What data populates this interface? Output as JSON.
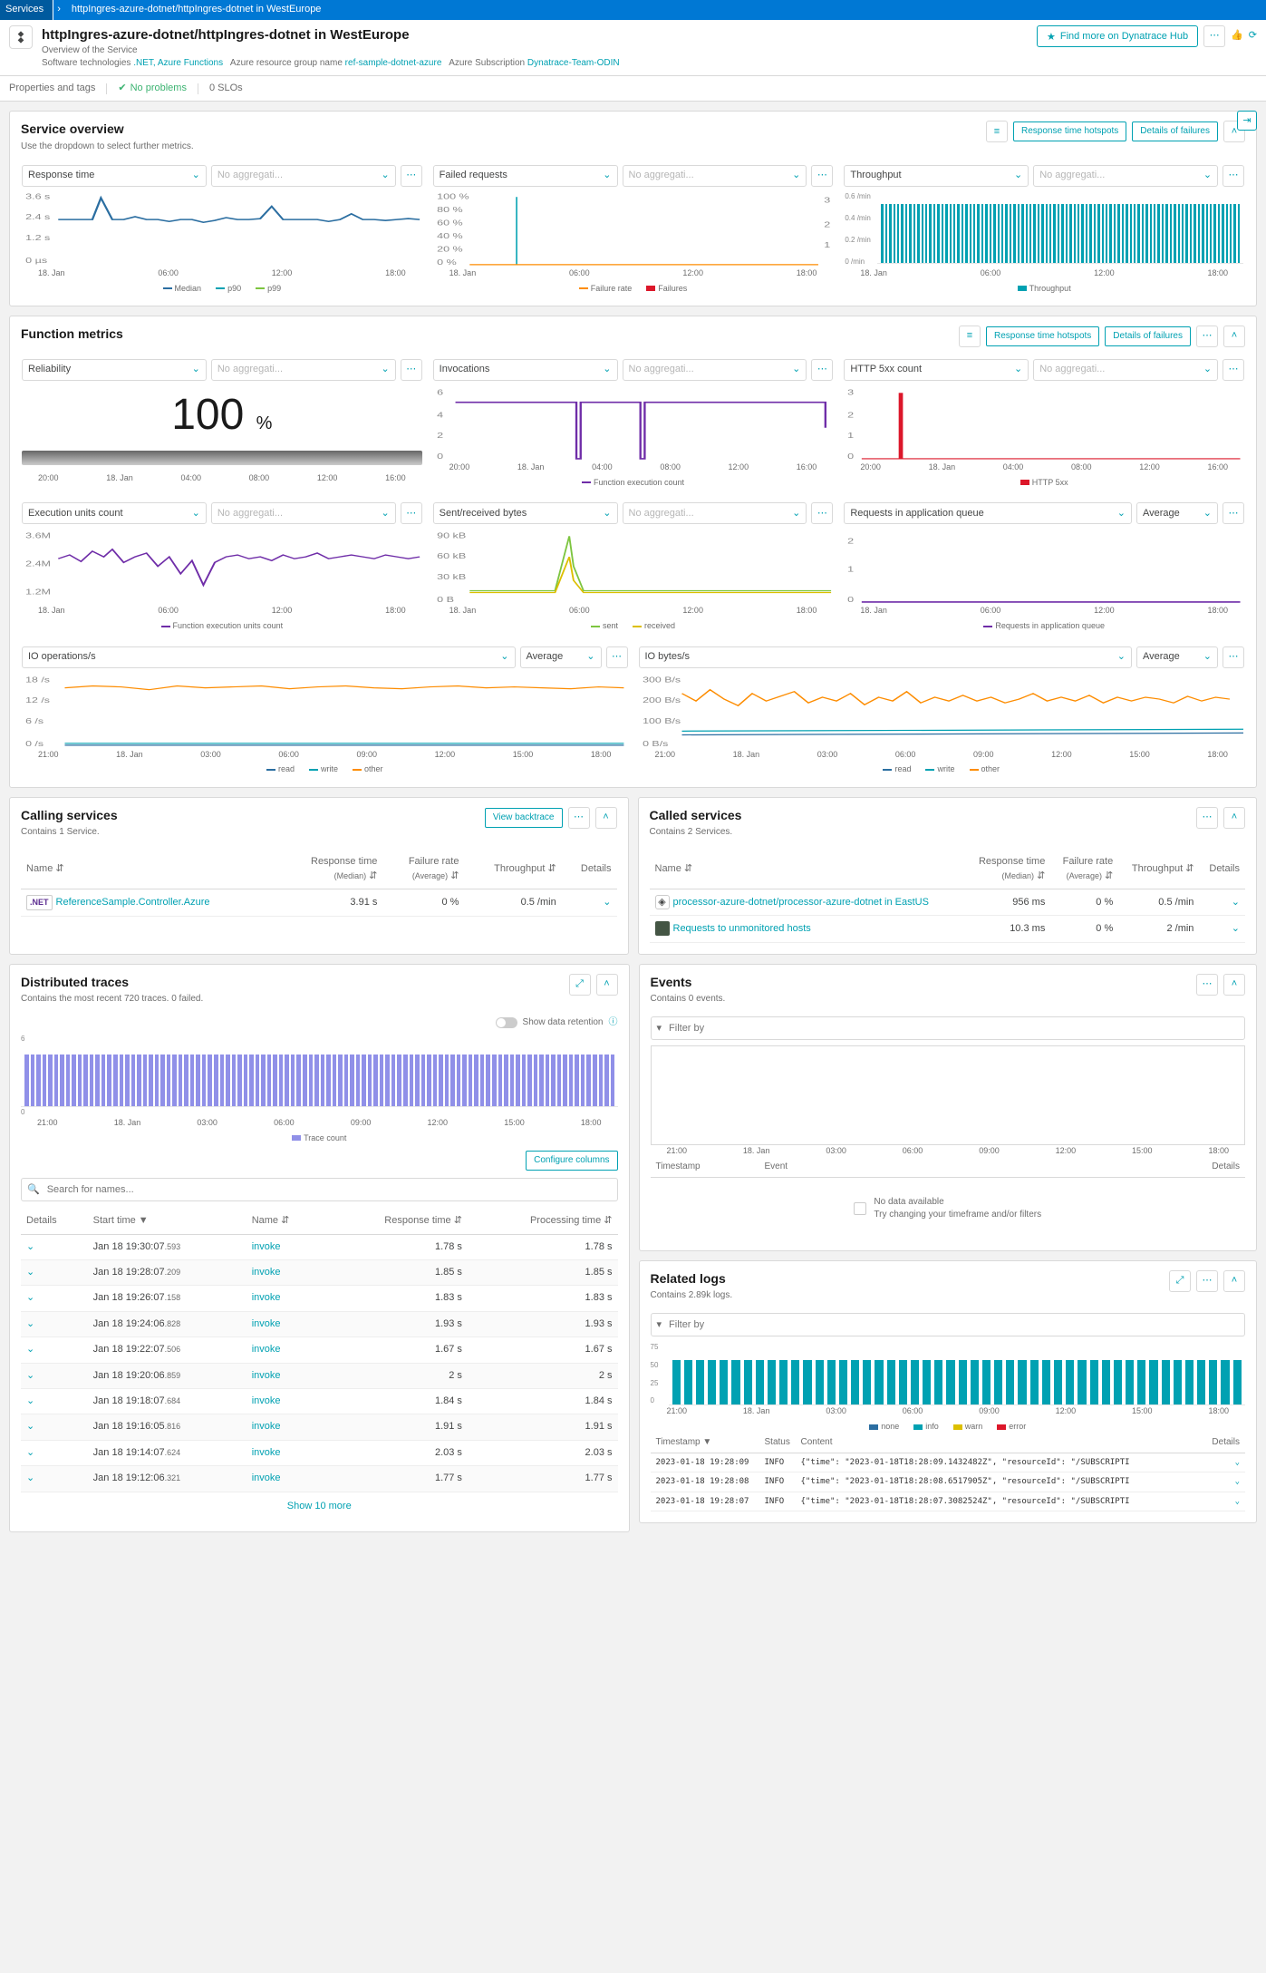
{
  "breadcrumb": {
    "root": "Services",
    "path": "httpIngres-azure-dotnet/httpIngres-dotnet in WestEurope"
  },
  "header": {
    "title": "httpIngres-azure-dotnet/httpIngres-dotnet in WestEurope",
    "subtitle": "Overview of the Service",
    "tech_label": "Software technologies",
    "tech_value": ".NET, Azure Functions",
    "rg_label": "Azure resource group name",
    "rg_value": "ref-sample-dotnet-azure",
    "sub_label": "Azure Subscription",
    "sub_value": "Dynatrace-Team-ODIN",
    "find_more": "Find more on Dynatrace Hub"
  },
  "pt": {
    "props": "Properties and tags",
    "no_problems": "No problems",
    "slos": "0 SLOs"
  },
  "overview": {
    "title": "Service overview",
    "hint": "Use the dropdown to select further metrics.",
    "rt_hotspots": "Response time hotspots",
    "failures": "Details of failures",
    "no_agg": "No aggregati..."
  },
  "charts": {
    "response": {
      "label": "Response time",
      "y": [
        "3.6 s",
        "2.4 s",
        "1.2 s",
        "0 µs"
      ],
      "x": [
        "18. Jan",
        "06:00",
        "12:00",
        "18:00"
      ],
      "legend": [
        "Median",
        "p90",
        "p99"
      ]
    },
    "failed": {
      "label": "Failed requests",
      "y": [
        "100 %",
        "80 %",
        "60 %",
        "40 %",
        "20 %",
        "0 %"
      ],
      "x": [
        "18. Jan",
        "06:00",
        "12:00",
        "18:00"
      ],
      "legend": [
        "Failure rate",
        "Failures"
      ]
    },
    "throughput": {
      "label": "Throughput",
      "y": [
        "0.6 /min",
        "0.4 /min",
        "0.2 /min",
        "0 /min"
      ],
      "x": [
        "18. Jan",
        "06:00",
        "12:00",
        "18:00"
      ],
      "legend": [
        "Throughput"
      ]
    },
    "reliability": {
      "label": "Reliability",
      "value": "100",
      "unit": "%",
      "x": [
        "20:00",
        "18. Jan",
        "04:00",
        "08:00",
        "12:00",
        "16:00"
      ]
    },
    "invocations": {
      "label": "Invocations",
      "y": [
        "6",
        "4",
        "2",
        "0"
      ],
      "x": [
        "20:00",
        "18. Jan",
        "04:00",
        "08:00",
        "12:00",
        "16:00"
      ],
      "legend": [
        "Function execution count"
      ]
    },
    "http5xx": {
      "label": "HTTP 5xx count",
      "y": [
        "3",
        "2",
        "1",
        "0"
      ],
      "x": [
        "20:00",
        "18. Jan",
        "04:00",
        "08:00",
        "12:00",
        "16:00"
      ],
      "legend": [
        "HTTP 5xx"
      ]
    },
    "execunits": {
      "label": "Execution units count",
      "y": [
        "3.6M",
        "2.4M",
        "1.2M"
      ],
      "x": [
        "18. Jan",
        "06:00",
        "12:00",
        "18:00"
      ],
      "legend": [
        "Function execution units count"
      ]
    },
    "bytes": {
      "label": "Sent/received bytes",
      "y": [
        "90 kB",
        "60 kB",
        "30 kB",
        "0 B"
      ],
      "x": [
        "18. Jan",
        "06:00",
        "12:00",
        "18:00"
      ],
      "legend": [
        "sent",
        "received"
      ]
    },
    "queue": {
      "label": "Requests in application queue",
      "agg": "Average",
      "y": [
        "2",
        "1",
        "0"
      ],
      "x": [
        "18. Jan",
        "06:00",
        "12:00",
        "18:00"
      ],
      "legend": [
        "Requests in application queue"
      ]
    },
    "ioops": {
      "label": "IO operations/s",
      "agg": "Average",
      "y": [
        "18 /s",
        "12 /s",
        "6 /s",
        "0 /s"
      ],
      "x": [
        "21:00",
        "18. Jan",
        "03:00",
        "06:00",
        "09:00",
        "12:00",
        "15:00",
        "18:00"
      ],
      "legend": [
        "read",
        "write",
        "other"
      ]
    },
    "iobytes": {
      "label": "IO bytes/s",
      "agg": "Average",
      "y": [
        "300 B/s",
        "200 B/s",
        "100 B/s",
        "0 B/s"
      ],
      "x": [
        "21:00",
        "18. Jan",
        "03:00",
        "06:00",
        "09:00",
        "12:00",
        "15:00",
        "18:00"
      ],
      "legend": [
        "read",
        "write",
        "other"
      ]
    }
  },
  "func": {
    "title": "Function metrics"
  },
  "calling": {
    "title": "Calling services",
    "sub": "Contains 1 Service.",
    "view_bt": "View backtrace",
    "cols": {
      "name": "Name",
      "rt": "Response time",
      "rt2": "(Median)",
      "fr": "Failure rate",
      "fr2": "(Average)",
      "tp": "Throughput",
      "dt": "Details"
    },
    "rows": [
      {
        "name": "ReferenceSample.Controller.Azure",
        "rt": "3.91 s",
        "fr": "0 %",
        "tp": "0.5 /min"
      }
    ]
  },
  "called": {
    "title": "Called services",
    "sub": "Contains 2 Services.",
    "rows": [
      {
        "name": "processor-azure-dotnet/processor-azure-dotnet in EastUS",
        "rt": "956 ms",
        "fr": "0 %",
        "tp": "0.5 /min"
      },
      {
        "name": "Requests to unmonitored hosts",
        "rt": "10.3 ms",
        "fr": "0 %",
        "tp": "2 /min"
      }
    ]
  },
  "traces": {
    "title": "Distributed traces",
    "sub": "Contains the most recent 720 traces. 0 failed.",
    "retain": "Show data retention",
    "cfg": "Configure columns",
    "search": "Search for names...",
    "show_more": "Show 10 more",
    "chart_x": [
      "21:00",
      "18. Jan",
      "03:00",
      "06:00",
      "09:00",
      "12:00",
      "15:00",
      "18:00"
    ],
    "chart_legend": "Trace count",
    "cols": {
      "d": "Details",
      "st": "Start time",
      "nm": "Name",
      "rt": "Response time",
      "pt": "Processing time"
    },
    "rows": [
      {
        "t": "Jan 18 19:30:07",
        "ms": "593",
        "n": "invoke",
        "rt": "1.78 s",
        "pt": "1.78 s"
      },
      {
        "t": "Jan 18 19:28:07",
        "ms": "209",
        "n": "invoke",
        "rt": "1.85 s",
        "pt": "1.85 s"
      },
      {
        "t": "Jan 18 19:26:07",
        "ms": "158",
        "n": "invoke",
        "rt": "1.83 s",
        "pt": "1.83 s"
      },
      {
        "t": "Jan 18 19:24:06",
        "ms": "828",
        "n": "invoke",
        "rt": "1.93 s",
        "pt": "1.93 s"
      },
      {
        "t": "Jan 18 19:22:07",
        "ms": "506",
        "n": "invoke",
        "rt": "1.67 s",
        "pt": "1.67 s"
      },
      {
        "t": "Jan 18 19:20:06",
        "ms": "859",
        "n": "invoke",
        "rt": "2 s",
        "pt": "2 s"
      },
      {
        "t": "Jan 18 19:18:07",
        "ms": "684",
        "n": "invoke",
        "rt": "1.84 s",
        "pt": "1.84 s"
      },
      {
        "t": "Jan 18 19:16:05",
        "ms": "816",
        "n": "invoke",
        "rt": "1.91 s",
        "pt": "1.91 s"
      },
      {
        "t": "Jan 18 19:14:07",
        "ms": "624",
        "n": "invoke",
        "rt": "2.03 s",
        "pt": "2.03 s"
      },
      {
        "t": "Jan 18 19:12:06",
        "ms": "321",
        "n": "invoke",
        "rt": "1.77 s",
        "pt": "1.77 s"
      }
    ]
  },
  "events": {
    "title": "Events",
    "sub": "Contains 0 events.",
    "filter": "Filter by",
    "chart_x": [
      "21:00",
      "18. Jan",
      "03:00",
      "06:00",
      "09:00",
      "12:00",
      "15:00",
      "18:00"
    ],
    "cols": {
      "ts": "Timestamp",
      "ev": "Event",
      "dt": "Details"
    },
    "empty1": "No data available",
    "empty2": "Try changing your timeframe and/or filters"
  },
  "logs": {
    "title": "Related logs",
    "sub": "Contains 2.89k logs.",
    "filter": "Filter by",
    "chart_y": [
      "75",
      "50",
      "25",
      "0"
    ],
    "chart_x": [
      "21:00",
      "18. Jan",
      "03:00",
      "06:00",
      "09:00",
      "12:00",
      "15:00",
      "18:00"
    ],
    "legend": [
      "none",
      "info",
      "warn",
      "error"
    ],
    "cols": {
      "ts": "Timestamp",
      "st": "Status",
      "ct": "Content",
      "dt": "Details"
    },
    "rows": [
      {
        "ts": "2023-01-18 19:28:09",
        "st": "INFO",
        "ct": "{\"time\": \"2023-01-18T18:28:09.1432482Z\", \"resourceId\": \"/SUBSCRIPTI"
      },
      {
        "ts": "2023-01-18 19:28:08",
        "st": "INFO",
        "ct": "{\"time\": \"2023-01-18T18:28:08.6517905Z\", \"resourceId\": \"/SUBSCRIPTI"
      },
      {
        "ts": "2023-01-18 19:28:07",
        "st": "INFO",
        "ct": "{\"time\": \"2023-01-18T18:28:07.3082524Z\", \"resourceId\": \"/SUBSCRIPTI"
      }
    ]
  },
  "chart_data": [
    {
      "id": "response_time",
      "type": "line",
      "x": [
        "18. Jan",
        "06:00",
        "12:00",
        "18:00"
      ],
      "ylim": [
        0,
        3.6
      ],
      "yunit": "s",
      "series": [
        {
          "name": "Median",
          "values": [
            2.4,
            2.4,
            2.4,
            2.4,
            3.4,
            2.4,
            2.4,
            2.5,
            2.4,
            2.4,
            2.4,
            2.4,
            2.4,
            2.4,
            2.4,
            2.4,
            2.4,
            2.4,
            2.4,
            2.4,
            2.4,
            2.4,
            2.9,
            2.4,
            2.4,
            2.4,
            2.4,
            2.4,
            2.4,
            2.4,
            2.4,
            2.4,
            2.4,
            2.6,
            2.4,
            2.4,
            2.4,
            2.4,
            2.4,
            2.4,
            2.4,
            2.4,
            2.4,
            2.4,
            2.4,
            2.4,
            2.4,
            2.4
          ]
        }
      ],
      "legend": [
        "Median",
        "p90",
        "p99"
      ]
    },
    {
      "id": "failed_requests",
      "type": "bar",
      "x": [
        "18. Jan",
        "06:00",
        "12:00",
        "18:00"
      ],
      "ylim": [
        0,
        100
      ],
      "yunit": "%",
      "series": [
        {
          "name": "Failure rate",
          "values": []
        },
        {
          "name": "Failures",
          "values": [
            0,
            0,
            0,
            0,
            0,
            0,
            0,
            0,
            0,
            0,
            0,
            0,
            0,
            0,
            0,
            0,
            0,
            0,
            0,
            0,
            0,
            0,
            0,
            0
          ]
        }
      ],
      "note": "single 100% failure-rate spike early 18. Jan"
    },
    {
      "id": "throughput",
      "type": "bar",
      "x": [
        "18. Jan",
        "06:00",
        "12:00",
        "18:00"
      ],
      "ylim": [
        0,
        0.6
      ],
      "yunit": "/min",
      "series": [
        {
          "name": "Throughput",
          "values": "constant≈0.5"
        }
      ]
    },
    {
      "id": "reliability",
      "type": "scalar",
      "value": 100,
      "unit": "%"
    },
    {
      "id": "invocations",
      "type": "line",
      "ylim": [
        0,
        6
      ],
      "series": [
        {
          "name": "Function execution count",
          "values": "steady≈5 with two drops to 0"
        }
      ]
    },
    {
      "id": "http_5xx",
      "type": "bar",
      "ylim": [
        0,
        3
      ],
      "series": [
        {
          "name": "HTTP 5xx",
          "values": "single spike to 3 early 18. Jan, otherwise 0"
        }
      ]
    },
    {
      "id": "execution_units",
      "type": "line",
      "ylim": [
        0,
        3600000
      ],
      "yunit": "units",
      "series": [
        {
          "name": "Function execution units count",
          "values": "noisy around 2.4M"
        }
      ]
    },
    {
      "id": "sent_received_bytes",
      "type": "line",
      "ylim": [
        0,
        90000
      ],
      "yunit": "B",
      "series": [
        {
          "name": "sent",
          "values": "baseline≈18kB, spike≈90kB"
        },
        {
          "name": "received",
          "values": "baseline≈18kB, spike≈55kB"
        }
      ]
    },
    {
      "id": "app_queue",
      "type": "line",
      "ylim": [
        0,
        2
      ],
      "series": [
        {
          "name": "Requests in application queue",
          "values": "flat 0"
        }
      ]
    },
    {
      "id": "io_ops",
      "type": "line",
      "yunit": "/s",
      "ylim": [
        0,
        18
      ],
      "series": [
        {
          "name": "read",
          "values": "flat≈0.5"
        },
        {
          "name": "write",
          "values": "flat≈0.5"
        },
        {
          "name": "other",
          "values": "noisy 14-17"
        }
      ]
    },
    {
      "id": "io_bytes",
      "type": "line",
      "yunit": "B/s",
      "ylim": [
        0,
        300
      ],
      "series": [
        {
          "name": "read",
          "values": "flat≈60"
        },
        {
          "name": "write",
          "values": "flat≈60"
        },
        {
          "name": "other",
          "values": "noisy 180-280"
        }
      ]
    },
    {
      "id": "trace_count",
      "type": "bar",
      "ylim": [
        0,
        6
      ],
      "series": [
        {
          "name": "Trace count",
          "values": "constant≈5"
        }
      ]
    },
    {
      "id": "log_count",
      "type": "bar",
      "ylim": [
        0,
        75
      ],
      "series": [
        {
          "name": "logs",
          "values": "constant≈55"
        }
      ]
    }
  ]
}
